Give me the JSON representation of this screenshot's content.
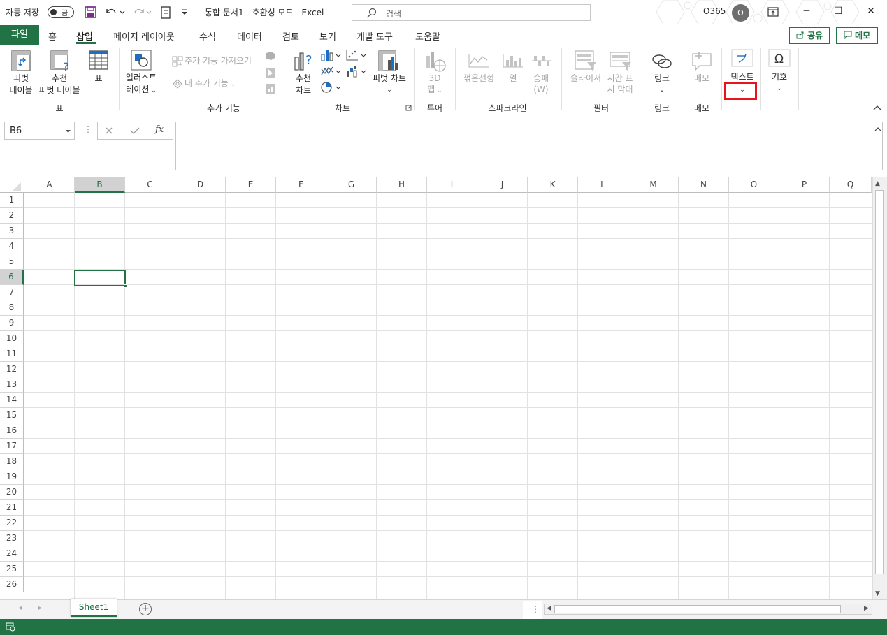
{
  "titlebar": {
    "autosave_label": "자동 저장",
    "autosave_state": "끔",
    "document_title": "통합 문서1  -  호환성 모드  -  Excel",
    "search_placeholder": "검색",
    "account_name": "O365",
    "avatar_letter": "O"
  },
  "tabs": {
    "file": "파일",
    "items": [
      "홈",
      "삽입",
      "페이지 레이아웃",
      "수식",
      "데이터",
      "검토",
      "보기",
      "개발 도구",
      "도움말"
    ],
    "active": "삽입",
    "share": "공유",
    "comments": "메모"
  },
  "ribbon": {
    "pivot_table": [
      "피벗",
      "테이블"
    ],
    "recommended_pivot": [
      "추천",
      "피벗 테이블"
    ],
    "table": "표",
    "group_tables": "표",
    "illustrations": [
      "일러스트",
      "레이션"
    ],
    "get_addins": "추가 기능 가져오기",
    "my_addins": "내 추가 기능",
    "group_addins": "추가 기능",
    "recommended_charts": [
      "추천",
      "차트"
    ],
    "pivot_chart": "피벗 차트",
    "group_charts": "차트",
    "map_3d": [
      "3D",
      "맵"
    ],
    "group_tours": "투어",
    "spark_line": "꺾은선형",
    "spark_column": "열",
    "spark_winloss": [
      "승패",
      "(W)"
    ],
    "group_sparklines": "스파크라인",
    "slicer": "슬라이서",
    "timeline": [
      "시간 표",
      "시 막대"
    ],
    "group_filters": "필터",
    "link": "링크",
    "group_links": "링크",
    "comment": "메모",
    "group_comments": "메모",
    "text": "텍스트",
    "symbols": "기호"
  },
  "formula": {
    "name_box": "B6",
    "fx": "fx",
    "value": ""
  },
  "grid": {
    "columns": [
      "A",
      "B",
      "C",
      "D",
      "E",
      "F",
      "G",
      "H",
      "I",
      "J",
      "K",
      "L",
      "M",
      "N",
      "O",
      "P",
      "Q"
    ],
    "rows": [
      "1",
      "2",
      "3",
      "4",
      "5",
      "6",
      "7",
      "8",
      "9",
      "10",
      "11",
      "12",
      "13",
      "14",
      "15",
      "16",
      "17",
      "18",
      "19",
      "20",
      "21",
      "22",
      "23",
      "24",
      "25",
      "26"
    ],
    "selected_column": "B",
    "selected_row": "6"
  },
  "sheets": {
    "tabs": [
      "Sheet1"
    ],
    "active": "Sheet1"
  },
  "colors": {
    "accent": "#217346",
    "highlight": "#e8141c"
  }
}
